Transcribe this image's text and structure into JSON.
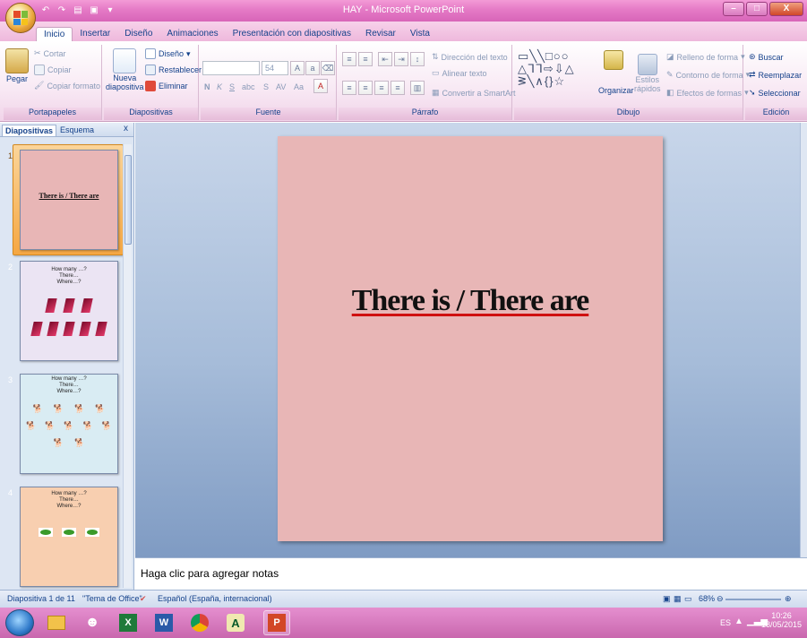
{
  "window": {
    "title": "HAY - Microsoft PowerPoint",
    "minimize": "–",
    "maximize": "□",
    "close": "X"
  },
  "ribbon_tabs": [
    "Inicio",
    "Insertar",
    "Diseño",
    "Animaciones",
    "Presentación con diapositivas",
    "Revisar",
    "Vista"
  ],
  "ribbon": {
    "clipboard": {
      "paste": "Pegar",
      "cut": "Cortar",
      "copy": "Copiar",
      "format_painter": "Copiar formato",
      "label": "Portapapeles"
    },
    "slides": {
      "new_slide_line1": "Nueva",
      "new_slide_line2": "diapositiva",
      "layout": "Diseño",
      "reset": "Restablecer",
      "delete": "Eliminar",
      "label": "Diapositivas"
    },
    "font": {
      "size": "54",
      "label": "Fuente",
      "bold": "N",
      "italic": "K",
      "underline": "S"
    },
    "paragraph": {
      "text_direction": "Dirección del texto",
      "align_text": "Alinear texto",
      "smartart": "Convertir a SmartArt",
      "label": "Párrafo"
    },
    "drawing": {
      "arrange": "Organizar",
      "quick_styles_line1": "Estilos",
      "quick_styles_line2": "rápidos",
      "shape_fill": "Relleno de forma",
      "shape_outline": "Contorno de forma",
      "shape_effects": "Efectos de formas",
      "label": "Dibujo"
    },
    "editing": {
      "find": "Buscar",
      "replace": "Reemplazar",
      "select": "Seleccionar",
      "label": "Edición"
    }
  },
  "panel": {
    "tab_slides": "Diapositivas",
    "tab_outline": "Esquema",
    "close": "x",
    "thumbnails": [
      {
        "number": "1",
        "title": "There is / There are"
      },
      {
        "number": "2",
        "lines": [
          "How many …?",
          "There…",
          "Where…?"
        ]
      },
      {
        "number": "3",
        "lines": [
          "How many …?",
          "There…",
          "Where…?"
        ]
      },
      {
        "number": "4",
        "lines": [
          "How many …?",
          "There…",
          "Where…?"
        ]
      }
    ]
  },
  "slide": {
    "title": "There is / There are",
    "background": "#e8b6b6"
  },
  "notes": {
    "placeholder": "Haga clic para agregar notas"
  },
  "status": {
    "slide_counter": "Diapositiva 1 de 11",
    "theme": "\"Tema de Office\"",
    "language": "Español (España, internacional)",
    "zoom": "68%"
  },
  "taskbar": {
    "language": "ES",
    "time": "10:26",
    "date": "18/05/2015"
  },
  "colors": {
    "accent_pink": "#e57ac6",
    "ribbon_text": "#15428b"
  }
}
